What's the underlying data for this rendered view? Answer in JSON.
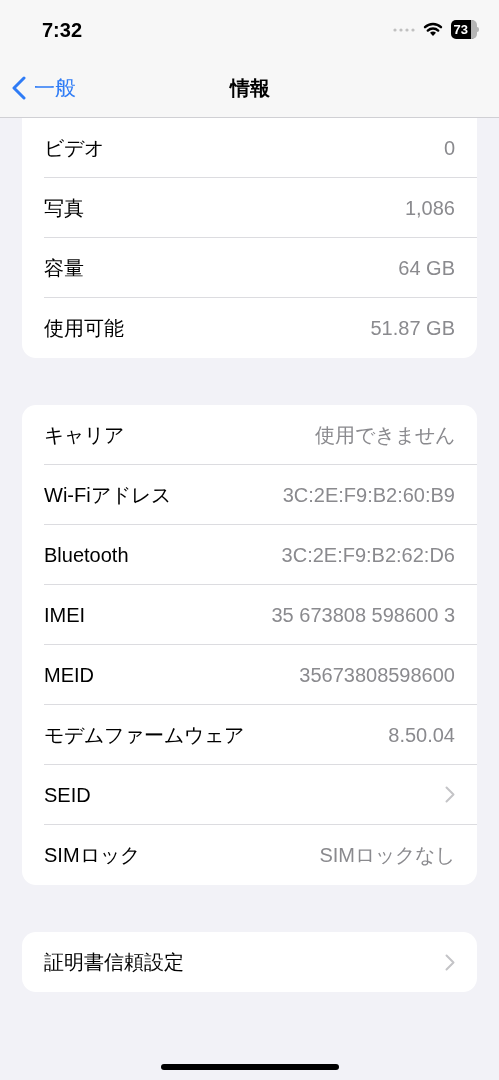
{
  "status_bar": {
    "time": "7:32",
    "battery": "73"
  },
  "nav": {
    "back": "一般",
    "title": "情報"
  },
  "groups": [
    {
      "cut_top": true,
      "rows": [
        {
          "kind": "value",
          "label": "ビデオ",
          "value": "0"
        },
        {
          "kind": "value",
          "label": "写真",
          "value": "1,086"
        },
        {
          "kind": "value",
          "label": "容量",
          "value": "64 GB"
        },
        {
          "kind": "value",
          "label": "使用可能",
          "value": "51.87 GB"
        }
      ]
    },
    {
      "cut_top": false,
      "rows": [
        {
          "kind": "value",
          "label": "キャリア",
          "value": "使用できません"
        },
        {
          "kind": "value",
          "label": "Wi-Fiアドレス",
          "value": "3C:2E:F9:B2:60:B9"
        },
        {
          "kind": "value",
          "label": "Bluetooth",
          "value": "3C:2E:F9:B2:62:D6"
        },
        {
          "kind": "value",
          "label": "IMEI",
          "value": "35 673808 598600 3"
        },
        {
          "kind": "value",
          "label": "MEID",
          "value": "35673808598600"
        },
        {
          "kind": "value",
          "label": "モデムファームウェア",
          "value": "8.50.04"
        },
        {
          "kind": "chevron",
          "label": "SEID"
        },
        {
          "kind": "value",
          "label": "SIMロック",
          "value": "SIMロックなし"
        }
      ]
    },
    {
      "cut_top": false,
      "rows": [
        {
          "kind": "chevron",
          "label": "証明書信頼設定"
        }
      ]
    }
  ]
}
